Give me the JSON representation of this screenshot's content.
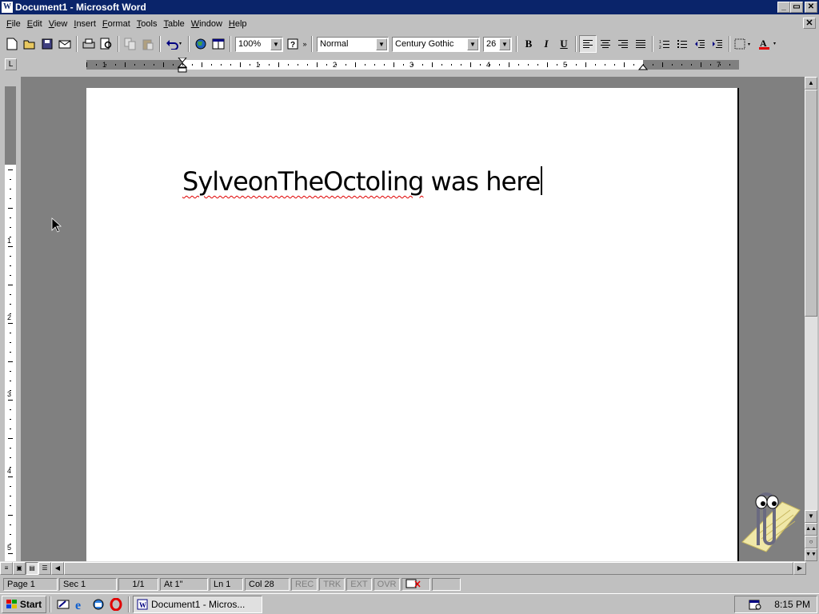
{
  "window": {
    "title": "Document1 - Microsoft Word",
    "doc_icon": "W"
  },
  "menu": [
    "File",
    "Edit",
    "View",
    "Insert",
    "Format",
    "Tools",
    "Table",
    "Window",
    "Help"
  ],
  "toolbar": {
    "zoom": "100%",
    "style": "Normal",
    "font": "Century Gothic",
    "size": "26"
  },
  "ruler": {
    "h_numbers": [
      "1",
      "1",
      "2",
      "3",
      "4",
      "5",
      "7"
    ],
    "v_numbers": [
      "1",
      "2",
      "3",
      "4",
      "5"
    ]
  },
  "document": {
    "text_misspelled": "SylveonTheOctoling",
    "text_rest": " was here"
  },
  "status": {
    "page": "Page  1",
    "sec": "Sec  1",
    "pages": "1/1",
    "at": "At  1\"",
    "ln": "Ln  1",
    "col": "Col  28",
    "rec": "REC",
    "trk": "TRK",
    "ext": "EXT",
    "ovr": "OVR"
  },
  "taskbar": {
    "start": "Start",
    "task": "Document1 - Micros...",
    "clock": "8:15 PM"
  },
  "colors": {
    "title_bg": "#0a246a",
    "face": "#c0c0c0",
    "workspace": "#808080",
    "font_color": "#e00000"
  }
}
